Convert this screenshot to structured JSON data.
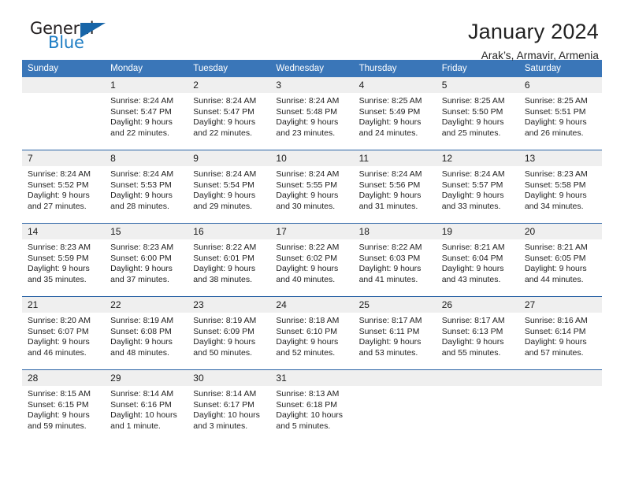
{
  "brand": {
    "name_top": "General",
    "name_bottom": "Blue",
    "accent_color": "#1765a8",
    "text_color": "#231f20"
  },
  "header": {
    "title": "January 2024",
    "subtitle": "Arak’s, Armavir, Armenia"
  },
  "theme": {
    "header_blue": "#3a76b8",
    "row_border_blue": "#2a63a5",
    "daynum_band": "#efefef"
  },
  "calendar": {
    "weekday_headers": [
      "Sunday",
      "Monday",
      "Tuesday",
      "Wednesday",
      "Thursday",
      "Friday",
      "Saturday"
    ],
    "weeks": [
      [
        {
          "day": "",
          "empty": true
        },
        {
          "day": "1",
          "sunrise": "Sunrise: 8:24 AM",
          "sunset": "Sunset: 5:47 PM",
          "daylight_1": "Daylight: 9 hours",
          "daylight_2": "and 22 minutes."
        },
        {
          "day": "2",
          "sunrise": "Sunrise: 8:24 AM",
          "sunset": "Sunset: 5:47 PM",
          "daylight_1": "Daylight: 9 hours",
          "daylight_2": "and 22 minutes."
        },
        {
          "day": "3",
          "sunrise": "Sunrise: 8:24 AM",
          "sunset": "Sunset: 5:48 PM",
          "daylight_1": "Daylight: 9 hours",
          "daylight_2": "and 23 minutes."
        },
        {
          "day": "4",
          "sunrise": "Sunrise: 8:25 AM",
          "sunset": "Sunset: 5:49 PM",
          "daylight_1": "Daylight: 9 hours",
          "daylight_2": "and 24 minutes."
        },
        {
          "day": "5",
          "sunrise": "Sunrise: 8:25 AM",
          "sunset": "Sunset: 5:50 PM",
          "daylight_1": "Daylight: 9 hours",
          "daylight_2": "and 25 minutes."
        },
        {
          "day": "6",
          "sunrise": "Sunrise: 8:25 AM",
          "sunset": "Sunset: 5:51 PM",
          "daylight_1": "Daylight: 9 hours",
          "daylight_2": "and 26 minutes."
        }
      ],
      [
        {
          "day": "7",
          "sunrise": "Sunrise: 8:24 AM",
          "sunset": "Sunset: 5:52 PM",
          "daylight_1": "Daylight: 9 hours",
          "daylight_2": "and 27 minutes."
        },
        {
          "day": "8",
          "sunrise": "Sunrise: 8:24 AM",
          "sunset": "Sunset: 5:53 PM",
          "daylight_1": "Daylight: 9 hours",
          "daylight_2": "and 28 minutes."
        },
        {
          "day": "9",
          "sunrise": "Sunrise: 8:24 AM",
          "sunset": "Sunset: 5:54 PM",
          "daylight_1": "Daylight: 9 hours",
          "daylight_2": "and 29 minutes."
        },
        {
          "day": "10",
          "sunrise": "Sunrise: 8:24 AM",
          "sunset": "Sunset: 5:55 PM",
          "daylight_1": "Daylight: 9 hours",
          "daylight_2": "and 30 minutes."
        },
        {
          "day": "11",
          "sunrise": "Sunrise: 8:24 AM",
          "sunset": "Sunset: 5:56 PM",
          "daylight_1": "Daylight: 9 hours",
          "daylight_2": "and 31 minutes."
        },
        {
          "day": "12",
          "sunrise": "Sunrise: 8:24 AM",
          "sunset": "Sunset: 5:57 PM",
          "daylight_1": "Daylight: 9 hours",
          "daylight_2": "and 33 minutes."
        },
        {
          "day": "13",
          "sunrise": "Sunrise: 8:23 AM",
          "sunset": "Sunset: 5:58 PM",
          "daylight_1": "Daylight: 9 hours",
          "daylight_2": "and 34 minutes."
        }
      ],
      [
        {
          "day": "14",
          "sunrise": "Sunrise: 8:23 AM",
          "sunset": "Sunset: 5:59 PM",
          "daylight_1": "Daylight: 9 hours",
          "daylight_2": "and 35 minutes."
        },
        {
          "day": "15",
          "sunrise": "Sunrise: 8:23 AM",
          "sunset": "Sunset: 6:00 PM",
          "daylight_1": "Daylight: 9 hours",
          "daylight_2": "and 37 minutes."
        },
        {
          "day": "16",
          "sunrise": "Sunrise: 8:22 AM",
          "sunset": "Sunset: 6:01 PM",
          "daylight_1": "Daylight: 9 hours",
          "daylight_2": "and 38 minutes."
        },
        {
          "day": "17",
          "sunrise": "Sunrise: 8:22 AM",
          "sunset": "Sunset: 6:02 PM",
          "daylight_1": "Daylight: 9 hours",
          "daylight_2": "and 40 minutes."
        },
        {
          "day": "18",
          "sunrise": "Sunrise: 8:22 AM",
          "sunset": "Sunset: 6:03 PM",
          "daylight_1": "Daylight: 9 hours",
          "daylight_2": "and 41 minutes."
        },
        {
          "day": "19",
          "sunrise": "Sunrise: 8:21 AM",
          "sunset": "Sunset: 6:04 PM",
          "daylight_1": "Daylight: 9 hours",
          "daylight_2": "and 43 minutes."
        },
        {
          "day": "20",
          "sunrise": "Sunrise: 8:21 AM",
          "sunset": "Sunset: 6:05 PM",
          "daylight_1": "Daylight: 9 hours",
          "daylight_2": "and 44 minutes."
        }
      ],
      [
        {
          "day": "21",
          "sunrise": "Sunrise: 8:20 AM",
          "sunset": "Sunset: 6:07 PM",
          "daylight_1": "Daylight: 9 hours",
          "daylight_2": "and 46 minutes."
        },
        {
          "day": "22",
          "sunrise": "Sunrise: 8:19 AM",
          "sunset": "Sunset: 6:08 PM",
          "daylight_1": "Daylight: 9 hours",
          "daylight_2": "and 48 minutes."
        },
        {
          "day": "23",
          "sunrise": "Sunrise: 8:19 AM",
          "sunset": "Sunset: 6:09 PM",
          "daylight_1": "Daylight: 9 hours",
          "daylight_2": "and 50 minutes."
        },
        {
          "day": "24",
          "sunrise": "Sunrise: 8:18 AM",
          "sunset": "Sunset: 6:10 PM",
          "daylight_1": "Daylight: 9 hours",
          "daylight_2": "and 52 minutes."
        },
        {
          "day": "25",
          "sunrise": "Sunrise: 8:17 AM",
          "sunset": "Sunset: 6:11 PM",
          "daylight_1": "Daylight: 9 hours",
          "daylight_2": "and 53 minutes."
        },
        {
          "day": "26",
          "sunrise": "Sunrise: 8:17 AM",
          "sunset": "Sunset: 6:13 PM",
          "daylight_1": "Daylight: 9 hours",
          "daylight_2": "and 55 minutes."
        },
        {
          "day": "27",
          "sunrise": "Sunrise: 8:16 AM",
          "sunset": "Sunset: 6:14 PM",
          "daylight_1": "Daylight: 9 hours",
          "daylight_2": "and 57 minutes."
        }
      ],
      [
        {
          "day": "28",
          "sunrise": "Sunrise: 8:15 AM",
          "sunset": "Sunset: 6:15 PM",
          "daylight_1": "Daylight: 9 hours",
          "daylight_2": "and 59 minutes."
        },
        {
          "day": "29",
          "sunrise": "Sunrise: 8:14 AM",
          "sunset": "Sunset: 6:16 PM",
          "daylight_1": "Daylight: 10 hours",
          "daylight_2": "and 1 minute."
        },
        {
          "day": "30",
          "sunrise": "Sunrise: 8:14 AM",
          "sunset": "Sunset: 6:17 PM",
          "daylight_1": "Daylight: 10 hours",
          "daylight_2": "and 3 minutes."
        },
        {
          "day": "31",
          "sunrise": "Sunrise: 8:13 AM",
          "sunset": "Sunset: 6:18 PM",
          "daylight_1": "Daylight: 10 hours",
          "daylight_2": "and 5 minutes."
        },
        {
          "day": "",
          "empty": true
        },
        {
          "day": "",
          "empty": true
        },
        {
          "day": "",
          "empty": true
        }
      ]
    ]
  }
}
